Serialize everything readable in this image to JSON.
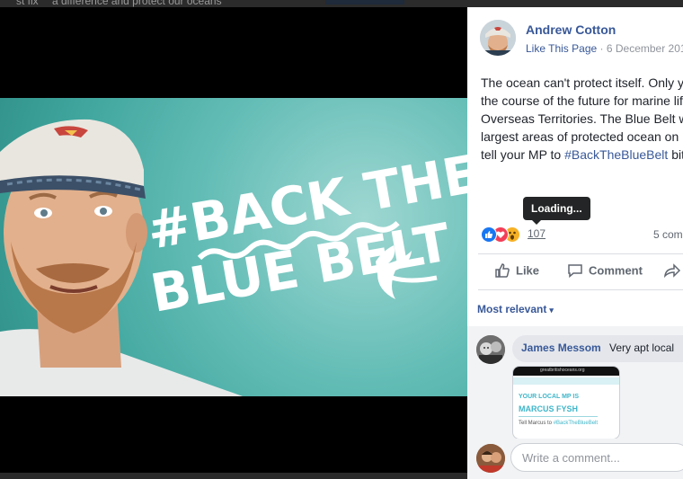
{
  "background_text": {
    "left": "st  fix",
    "right": "a difference and protect our oceans"
  },
  "photo": {
    "headline_line1": "#BACK THE",
    "headline_line2": "BLUE BELT"
  },
  "post": {
    "author": "Andrew Cotton",
    "like_page": "Like This Page",
    "separator": " · ",
    "date": "6 December 201",
    "text_lines": [
      "The ocean can't protect itself. Only y",
      "the course of the future for marine lif",
      "Overseas Territories. The Blue Belt w",
      "largest areas of protected ocean on",
      "tell your MP to "
    ],
    "hashtag": "#BackTheBlueBelt",
    "hashtag_tail": " bit"
  },
  "tooltip": "Loading...",
  "reactions": {
    "count": "107",
    "comments": "5 com",
    "icons": [
      "like-icon",
      "love-icon",
      "wow-icon"
    ],
    "colors": {
      "like": "#1877f2",
      "love": "#f33e58",
      "wow": "#f7b125"
    }
  },
  "actions": {
    "like": "Like",
    "comment": "Comment"
  },
  "sort": {
    "label": "Most relevant",
    "caret": "▾"
  },
  "comment": {
    "name": "James Messom",
    "text": "Very apt local",
    "image": {
      "url": "greatbritishoceans.org",
      "line1": "YOUR LOCAL MP IS",
      "line2": "MARCUS FYSH",
      "line3_prefix": "Tell Marcus to ",
      "line3_hashtag": "#BackTheBlueBelt"
    }
  },
  "composer": {
    "placeholder": "Write a comment..."
  },
  "colors": {
    "link": "#385898",
    "teal": "#5fbab3"
  }
}
